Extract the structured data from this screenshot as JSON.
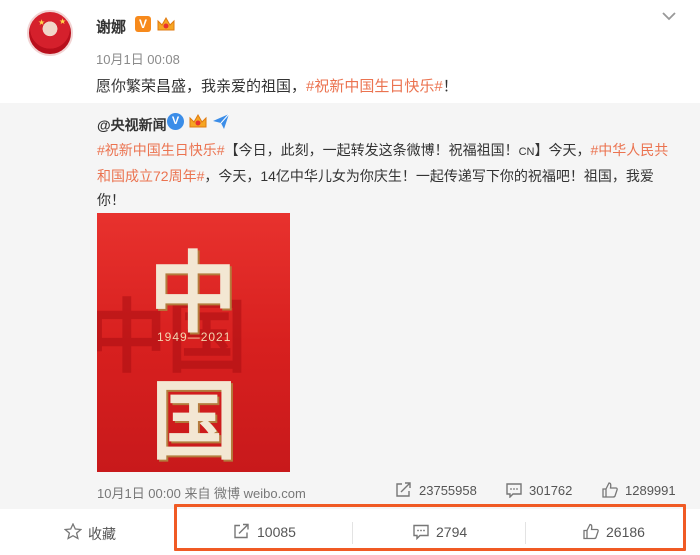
{
  "post": {
    "author": "谢娜",
    "verified_badge": "V",
    "timestamp": "10月1日 00:08",
    "text_before": "愿你繁荣昌盛，我亲爱的祖国，",
    "hashtag": "#祝新中国生日快乐#",
    "text_after": "！"
  },
  "repost": {
    "author": "@央视新闻",
    "verified_badge": "V",
    "hashtag_1": "#祝新中国生日快乐#",
    "text_1": "【今日，此刻，一起转发这条微博！祝福祖国！",
    "cn_tag": "CN",
    "text_2": "】今天，",
    "hashtag_2": "#中华人民共和国成立72周年#",
    "text_3": "，今天，14亿中华儿女为你庆生！一起传递写下你的祝福吧！祖国，我爱你！",
    "poster": {
      "char_top": "中",
      "char_bottom": "国",
      "years": "1949—2021",
      "bg_glyph": "中国"
    },
    "meta": "10月1日 00:00 来自 微博 weibo.com",
    "stats": {
      "reposts": "23755958",
      "comments": "301762",
      "likes": "1289991"
    }
  },
  "actions": {
    "favorite_label": "收藏",
    "repost_count": "10085",
    "comment_count": "2794",
    "like_count": "26186"
  },
  "colors": {
    "hashtag": "#eb7350",
    "highlight_box": "#f05a24",
    "verified_orange": "#f78a1c",
    "verified_blue": "#3b8de8"
  }
}
